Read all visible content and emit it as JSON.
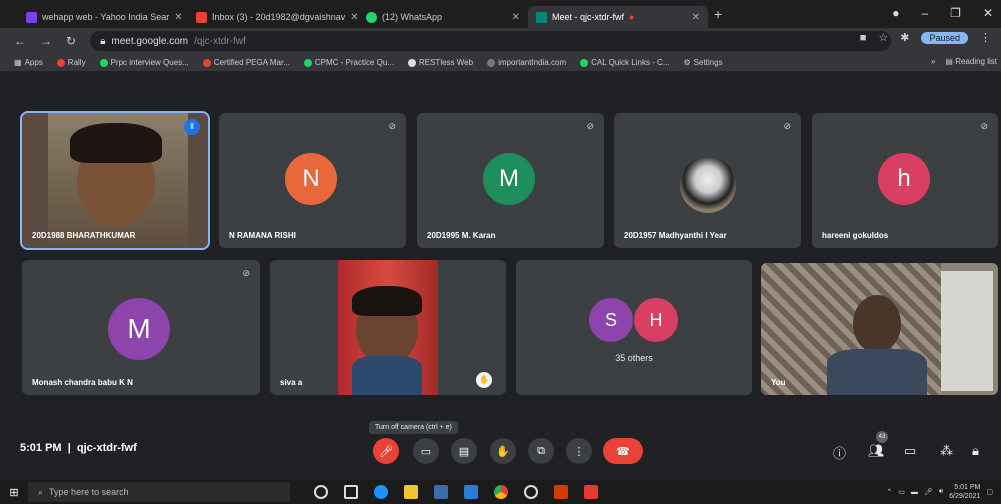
{
  "browser": {
    "tabs": [
      {
        "label": "wehapp web - Yahoo India Sear",
        "color": "#7e3ff2"
      },
      {
        "label": "Inbox (3) - 20d1982@dgvaishnav",
        "color": "#ea4335"
      },
      {
        "label": "(12) WhatsApp",
        "color": "#25d366"
      },
      {
        "label": "Meet - qjc-xtdr-fwf",
        "color": "#00897b"
      }
    ],
    "url_host": "meet.google.com",
    "url_path": "/qjc-xtdr-fwf",
    "profile_label": "Paused",
    "bookmarks": [
      "Apps",
      "Rally",
      "Prpc interview Ques...",
      "Certified PEGA Mar...",
      "CPMC - Practice Qu...",
      "RESTless Web",
      "importantIndia.com",
      "CAL Quick Links - C...",
      "Settings"
    ],
    "reading_list": "Reading list"
  },
  "participants": [
    {
      "name": "20D1988 BHARATHKUMAR",
      "type": "video"
    },
    {
      "name": "N RAMANA RISHI",
      "initial": "N",
      "color": "#e8683c"
    },
    {
      "name": "20D1995 M. Karan",
      "initial": "M",
      "color": "#1e8e5a"
    },
    {
      "name": "20D1957 Madhyanthi I Year",
      "type": "image"
    },
    {
      "name": "hareeni gokuldos",
      "initial": "h",
      "color": "#d93f62"
    },
    {
      "name": "Monash chandra babu K N",
      "initial": "M",
      "color": "#8e44ad"
    },
    {
      "name": "siva a",
      "type": "video"
    },
    {
      "name": "35 others",
      "initials": [
        "S",
        "H"
      ],
      "colors": [
        "#8e44ad",
        "#d93f62"
      ]
    },
    {
      "name": "You",
      "type": "video"
    }
  ],
  "meeting": {
    "time": "5:01 PM",
    "code": "qjc-xtdr-fwf",
    "tooltip": "Turn off camera (ctrl + e)",
    "participant_count": "43"
  },
  "taskbar": {
    "search_placeholder": "Type here to search",
    "clock_time": "5:01 PM",
    "clock_date": "6/29/2021"
  }
}
